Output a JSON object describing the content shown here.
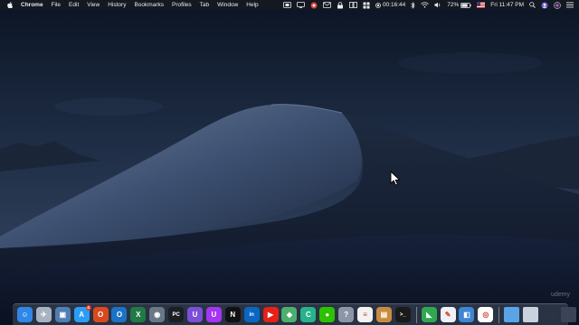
{
  "menubar": {
    "app_name": "Chrome",
    "menus": [
      "File",
      "Edit",
      "View",
      "History",
      "Bookmarks",
      "Profiles",
      "Tab",
      "Window",
      "Help"
    ],
    "timer": "00:16:44",
    "battery": "72%",
    "clock": "Fri 11:47 PM"
  },
  "dock": {
    "apps": [
      {
        "name": "Finder",
        "icon": "finder-icon",
        "color": "#2f87e8",
        "glyph": "☺"
      },
      {
        "name": "Launchpad",
        "icon": "launchpad-icon",
        "color": "#a8b3c2",
        "glyph": "✈"
      },
      {
        "name": "Preview",
        "icon": "preview-icon",
        "color": "#4f7fb3",
        "glyph": "▣"
      },
      {
        "name": "App Store",
        "icon": "app-store-icon",
        "color": "#2a9df4",
        "glyph": "A",
        "badge": "4"
      },
      {
        "name": "Office",
        "icon": "office-icon",
        "color": "#d9491f",
        "glyph": "O"
      },
      {
        "name": "Outlook",
        "icon": "outlook-icon",
        "color": "#1b72c6",
        "glyph": "O"
      },
      {
        "name": "Excel",
        "icon": "excel-icon",
        "color": "#1f7a44",
        "glyph": "X"
      },
      {
        "name": "Disk Utility",
        "icon": "disk-utility-icon",
        "color": "#6a7785",
        "glyph": "◉"
      },
      {
        "name": "PyCharm",
        "icon": "pycharm-icon",
        "color": "#1b1f24",
        "glyph": "PC"
      },
      {
        "name": "Ubuntu Kit",
        "icon": "u-app-icon",
        "color": "#7b4fd6",
        "glyph": "U"
      },
      {
        "name": "Udemy",
        "icon": "udemy-icon",
        "color": "#a435f0",
        "glyph": "U"
      },
      {
        "name": "Netflix",
        "icon": "netflix-icon",
        "color": "#111111",
        "glyph": "N"
      },
      {
        "name": "LinkedIn",
        "icon": "linkedin-icon",
        "color": "#0a66c2",
        "glyph": "in"
      },
      {
        "name": "YouTube",
        "icon": "youtube-icon",
        "color": "#e62117",
        "glyph": "▶"
      },
      {
        "name": "Maps",
        "icon": "maps-icon",
        "color": "#4caf6e",
        "glyph": "◆"
      },
      {
        "name": "CLion",
        "icon": "clion-icon",
        "color": "#27b38a",
        "glyph": "C"
      },
      {
        "name": "WeChat",
        "icon": "wechat-icon",
        "color": "#2dc100",
        "glyph": "●"
      },
      {
        "name": "Help",
        "icon": "help-icon",
        "color": "#8a95a5",
        "glyph": "?"
      },
      {
        "name": "Todoist",
        "icon": "todoist-icon",
        "color": "#f2f2f2",
        "glyph": "≡"
      },
      {
        "name": "Archive Utility",
        "icon": "archive-icon",
        "color": "#c98c3f",
        "glyph": "▤"
      },
      {
        "name": "Terminal",
        "icon": "terminal-icon",
        "color": "#1a1a1a",
        "glyph": ">_"
      }
    ],
    "right_apps": [
      {
        "name": "Camtasia",
        "icon": "camtasia-icon",
        "color": "#2fa84f",
        "glyph": "◣"
      },
      {
        "name": "TextEdit",
        "icon": "textedit-icon",
        "color": "#eef2f7",
        "glyph": "✎"
      },
      {
        "name": "Screenshot Tool",
        "icon": "screenshot-icon",
        "color": "#3f86d4",
        "glyph": "◧"
      },
      {
        "name": "Chrome",
        "icon": "chrome-icon",
        "color": "#ffffff",
        "glyph": "◎"
      }
    ],
    "folders": [
      {
        "name": "Downloads",
        "icon": "folder-icon",
        "color": "#5aa3e6"
      },
      {
        "name": "Documents",
        "icon": "stack-icon",
        "color": "#c9d2dc"
      },
      {
        "name": "Desktop",
        "icon": "stack-icon",
        "color": "#2a3344"
      },
      {
        "name": "Recent",
        "icon": "stack-icon",
        "color": "#3a4456"
      },
      {
        "name": "Screen",
        "icon": "stack-icon",
        "color": "#1f2836"
      }
    ],
    "trash": {
      "name": "Trash",
      "icon": "trash-icon"
    }
  },
  "watermark": "udemy"
}
